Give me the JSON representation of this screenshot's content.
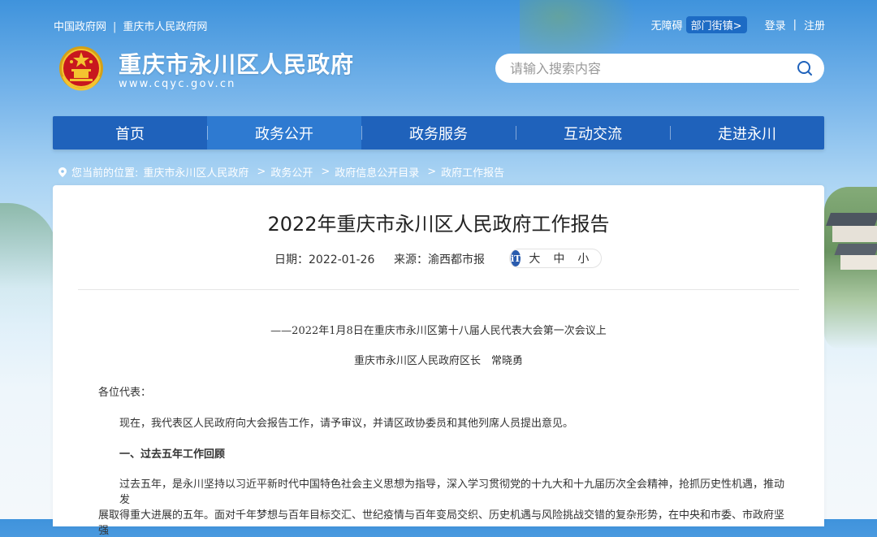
{
  "header": {
    "top_links": [
      "中国政府网",
      "重庆市人民政府网"
    ],
    "accessibility": "无障碍",
    "dept_button": "部门街镇>",
    "login": "登录",
    "register": "注册",
    "site_title": "重庆市永川区人民政府",
    "site_url": "www.cqyc.gov.cn",
    "search_placeholder": "请输入搜索内容"
  },
  "nav": {
    "items": [
      "首页",
      "政务公开",
      "政务服务",
      "互动交流",
      "走进永川"
    ],
    "active_index": 1
  },
  "breadcrumb": {
    "label": "您当前的位置:",
    "items": [
      "重庆市永川区人民政府",
      "政务公开",
      "政府信息公开目录",
      "政府工作报告"
    ]
  },
  "article": {
    "title": "2022年重庆市永川区人民政府工作报告",
    "date": "日期：2022-01-26",
    "source": "来源：渝西都市报",
    "font_size_options": [
      "大",
      "中",
      "小"
    ],
    "subtitle": "——2022年1月8日在重庆市永川区第十八届人民代表大会第一次会议上",
    "author": "重庆市永川区人民政府区长　常晓勇",
    "greeting": "各位代表：",
    "para1": "现在，我代表区人民政府向大会报告工作，请予审议，并请区政协委员和其他列席人员提出意见。",
    "heading1": "一、过去五年工作回顾",
    "para2": "过去五年，是永川坚持以习近平新时代中国特色社会主义思想为指导，深入学习贯彻党的十九大和十九届历次全会精神，抢抓历史性机遇，推动发",
    "para3": "展取得重大进展的五年。面对千年梦想与百年目标交汇、世纪疫情与百年变局交织、历史机遇与风险挑战交错的复杂形势，在中央和市委、市政府坚强"
  },
  "colors": {
    "nav": "#1f62bb",
    "nav_active": "#2e7ad1",
    "font_icon": "#2a5cae"
  }
}
